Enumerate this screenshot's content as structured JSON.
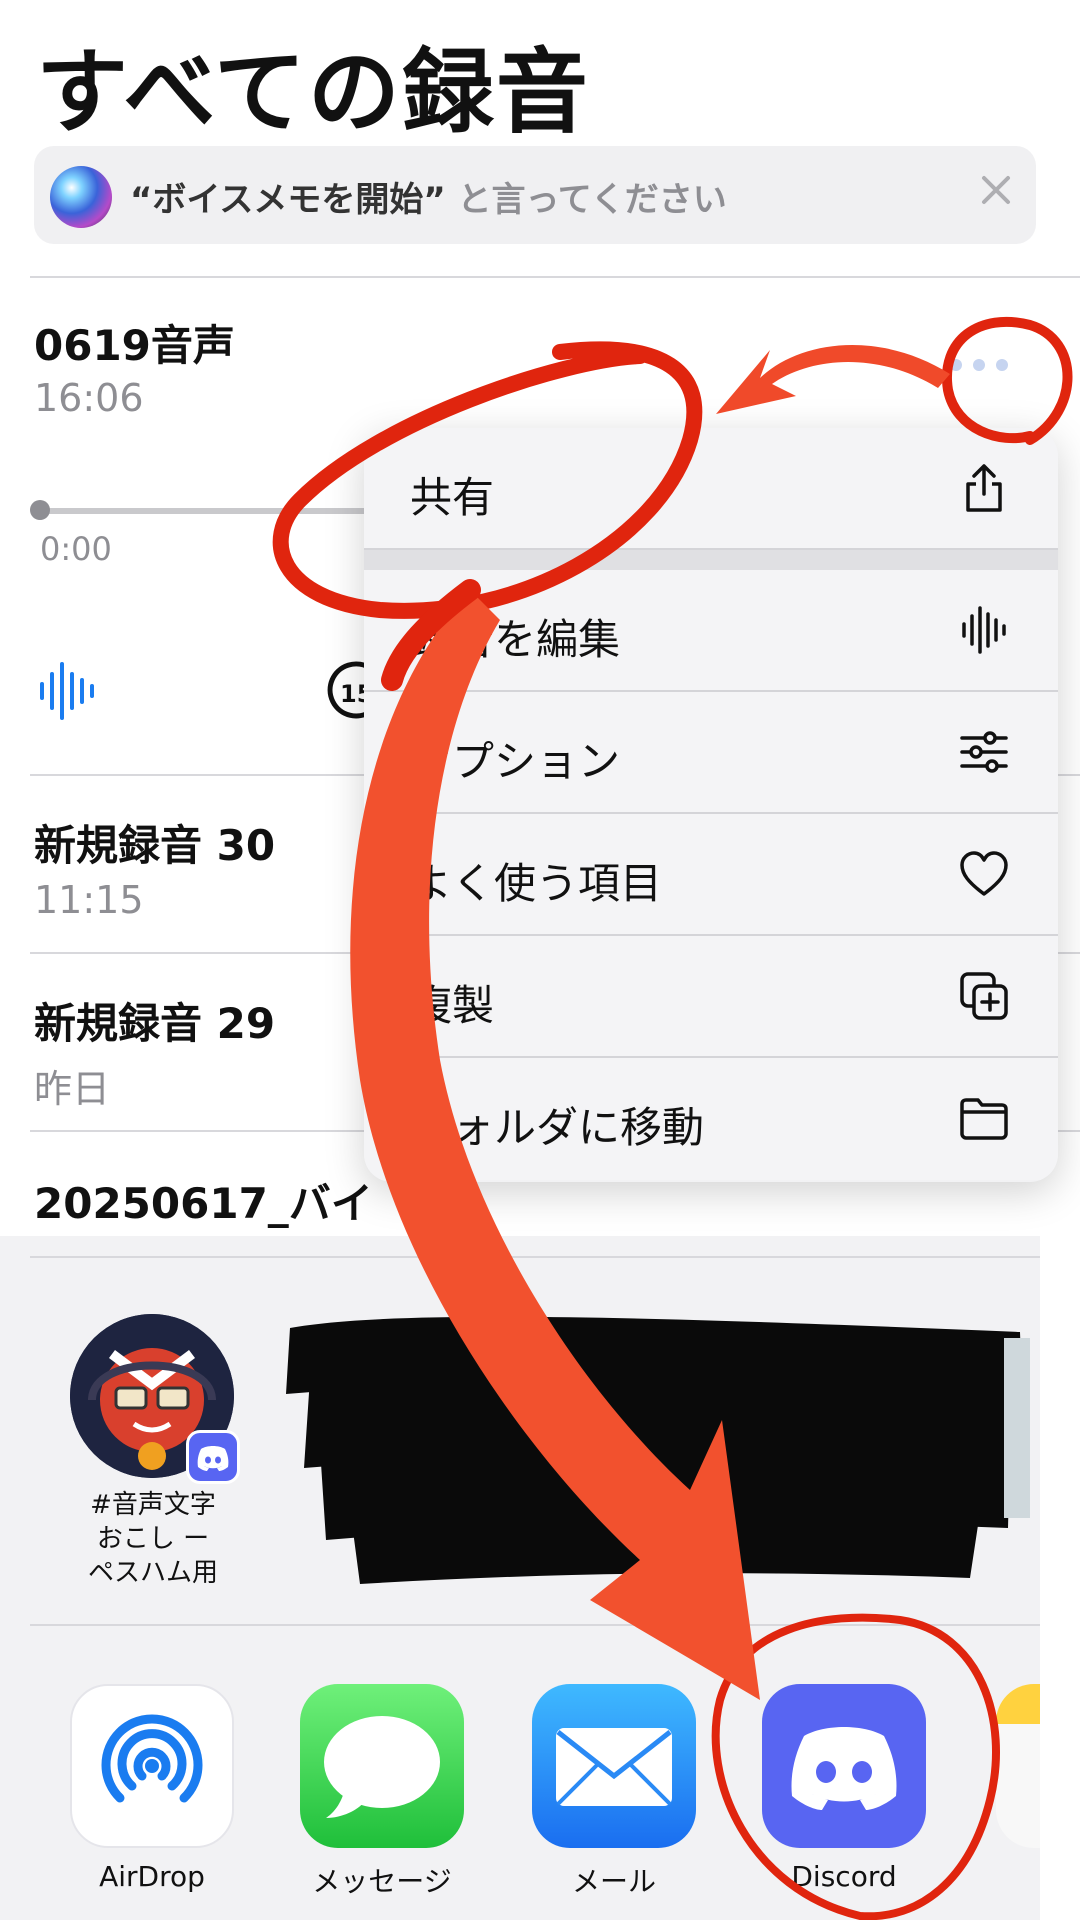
{
  "page": {
    "title": "すべての録音"
  },
  "siri": {
    "quote": "“ボイスメモを開始”",
    "hint": " と言ってください"
  },
  "recordings": [
    {
      "title": "0619音声",
      "subtitle": "16:06",
      "elapsed": "0:00"
    },
    {
      "title": "新規録音 30",
      "subtitle": "11:15"
    },
    {
      "title": "新規録音 29",
      "subtitle": "昨日"
    },
    {
      "title": "20250617_バイ"
    }
  ],
  "context_menu": {
    "items": [
      {
        "label": "共有",
        "icon": "share-icon"
      },
      {
        "label": "録音を編集",
        "icon": "waveform-icon"
      },
      {
        "label": "オプション",
        "icon": "sliders-icon"
      },
      {
        "label": "よく使う項目",
        "icon": "heart-icon"
      },
      {
        "label": "複製",
        "icon": "duplicate-icon"
      },
      {
        "label": "フォルダに移動",
        "icon": "folder-icon"
      }
    ]
  },
  "share_sheet": {
    "contact": {
      "name_line1": "#音声文字",
      "name_line2": "おこし ー",
      "name_line3": "ペスハム用",
      "badge_icon": "discord-icon"
    },
    "apps": [
      {
        "label": "AirDrop",
        "icon": "airdrop-icon",
        "color": "#ffffff"
      },
      {
        "label": "メッセージ",
        "icon": "messages-icon",
        "color": "#34c759"
      },
      {
        "label": "メール",
        "icon": "mail-icon",
        "color": "#1e90ff"
      },
      {
        "label": "Discord",
        "icon": "discord-icon",
        "color": "#5865f2"
      }
    ]
  },
  "colors": {
    "accent": "#007aff",
    "annotation": "#e8391d",
    "discord": "#5865f2"
  }
}
